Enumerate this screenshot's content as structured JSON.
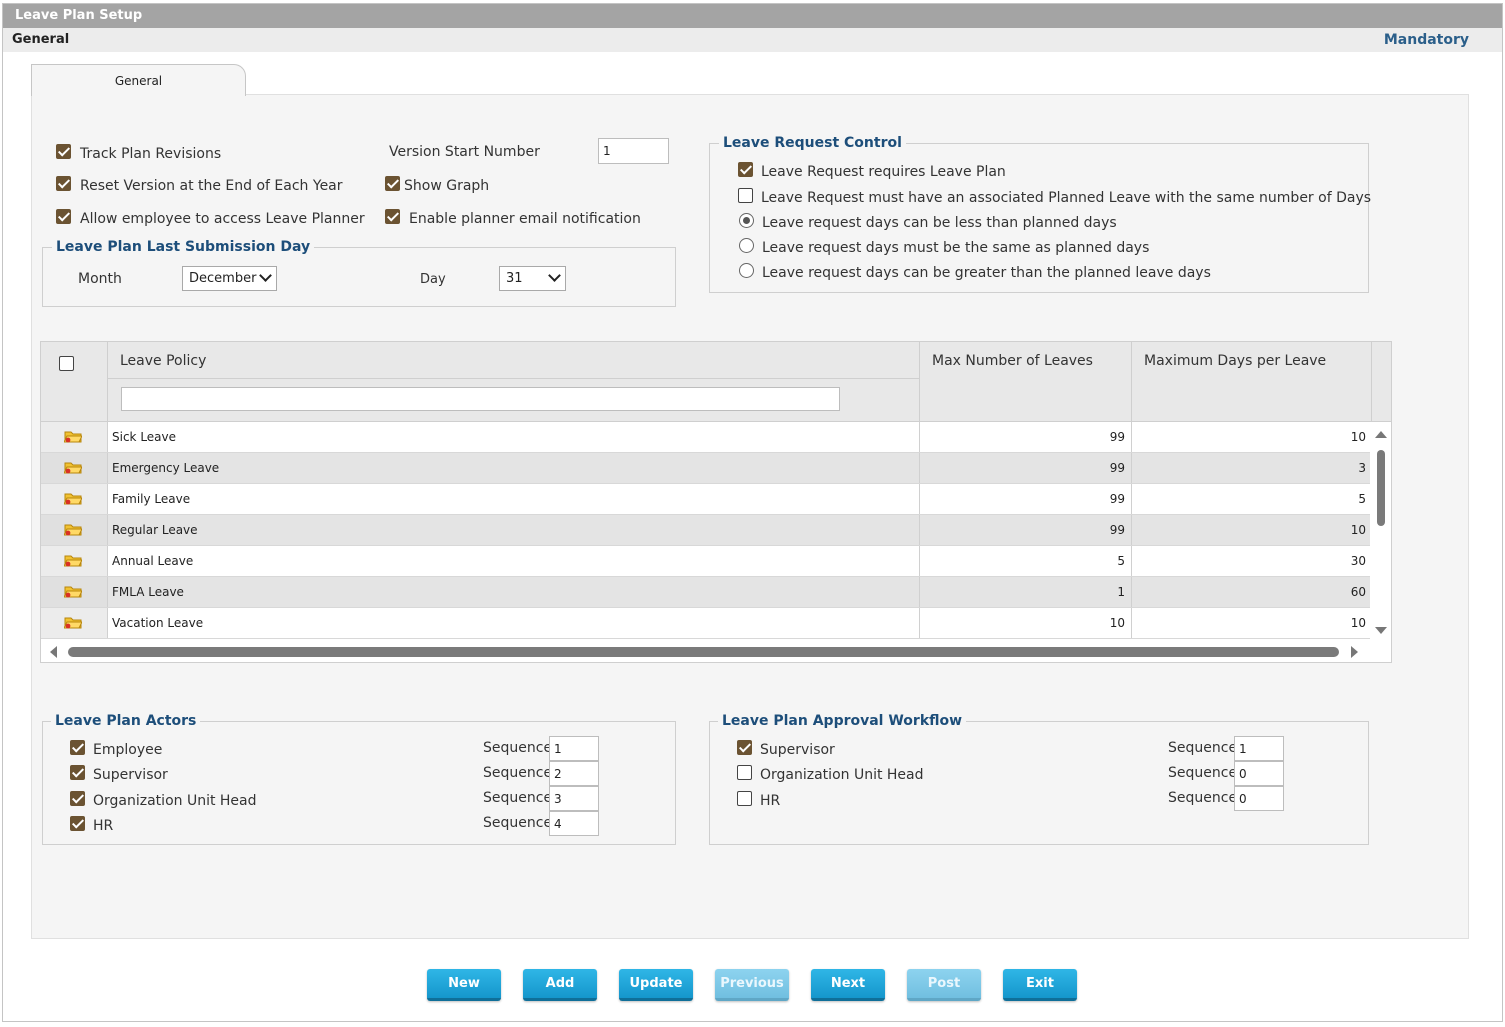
{
  "window": {
    "title": "Leave Plan Setup",
    "section": "General",
    "mandatory_label": "Mandatory"
  },
  "tab": {
    "label": "General"
  },
  "options": {
    "track_plan_revisions": {
      "label": "Track Plan Revisions",
      "checked": true
    },
    "reset_version": {
      "label": "Reset Version at the End of Each Year",
      "checked": true
    },
    "allow_employee": {
      "label": "Allow employee to access Leave Planner",
      "checked": true
    },
    "version_start_label": "Version Start Number",
    "version_start_value": "1",
    "show_graph": {
      "label": "Show Graph",
      "checked": true
    },
    "planner_email": {
      "label": "Enable planner email notification",
      "checked": true
    }
  },
  "submission": {
    "legend": "Leave Plan Last Submission Day",
    "month_label": "Month",
    "month_value": "December",
    "day_label": "Day",
    "day_value": "31"
  },
  "request_control": {
    "legend": "Leave Request Control",
    "requires_plan": {
      "label": "Leave Request requires Leave Plan",
      "checked": true
    },
    "same_days": {
      "label": "Leave Request must have an associated Planned Leave with the same number of Days",
      "checked": false
    },
    "radios": [
      {
        "label": "Leave request days can be less than planned days",
        "selected": true
      },
      {
        "label": "Leave request days must be the same as planned days",
        "selected": false
      },
      {
        "label": "Leave request days can be greater than the planned leave days",
        "selected": false
      }
    ]
  },
  "grid": {
    "columns": [
      "Leave Policy",
      "Max Number of Leaves",
      "Maximum Days per Leave"
    ],
    "filter_value": "",
    "rows": [
      {
        "policy": "Sick Leave",
        "max_leaves": "99",
        "max_days": "10"
      },
      {
        "policy": "Emergency Leave",
        "max_leaves": "99",
        "max_days": "3"
      },
      {
        "policy": "Family Leave",
        "max_leaves": "99",
        "max_days": "5"
      },
      {
        "policy": "Regular Leave",
        "max_leaves": "99",
        "max_days": "10"
      },
      {
        "policy": "Annual Leave",
        "max_leaves": "5",
        "max_days": "30"
      },
      {
        "policy": "FMLA Leave",
        "max_leaves": "1",
        "max_days": "60"
      },
      {
        "policy": "Vacation Leave",
        "max_leaves": "10",
        "max_days": "10"
      }
    ]
  },
  "actors": {
    "legend": "Leave Plan Actors",
    "sequence_label": "Sequence",
    "items": [
      {
        "label": "Employee",
        "checked": true,
        "sequence": "1"
      },
      {
        "label": "Supervisor",
        "checked": true,
        "sequence": "2"
      },
      {
        "label": "Organization Unit Head",
        "checked": true,
        "sequence": "3"
      },
      {
        "label": "HR",
        "checked": true,
        "sequence": "4"
      }
    ]
  },
  "workflow": {
    "legend": "Leave Plan Approval Workflow",
    "sequence_label": "Sequence",
    "items": [
      {
        "label": "Supervisor",
        "checked": true,
        "sequence": "1"
      },
      {
        "label": "Organization Unit Head",
        "checked": false,
        "sequence": "0"
      },
      {
        "label": "HR",
        "checked": false,
        "sequence": "0"
      }
    ]
  },
  "buttons": {
    "new": "New",
    "add": "Add",
    "update": "Update",
    "previous": "Previous",
    "next": "Next",
    "post": "Post",
    "exit": "Exit"
  },
  "colors": {
    "legend": "#1d4e7a",
    "button": "#1596cc",
    "checkbox": "#6b5332",
    "titlebar": "#a4a4a4"
  }
}
